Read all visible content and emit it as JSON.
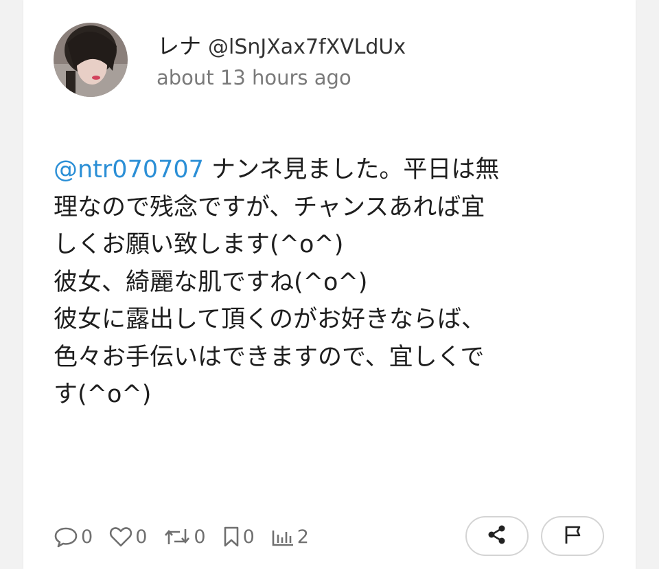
{
  "post": {
    "display_name": "レナ",
    "handle": "@lSnJXax7fXVLdUx",
    "timestamp": "about 13 hours ago",
    "mention": "@ntr070707",
    "lines": [
      " ナンネ見ました。平日は無",
      "理なので残念ですが、チャンスあれば宜",
      "しくお願い致します(^o^)",
      "彼女、綺麗な肌ですね(^o^)",
      "彼女に露出して頂くのがお好きならば、",
      "色々お手伝いはできますので、宜しくで",
      "す(^o^)"
    ]
  },
  "actions": {
    "replies": "0",
    "likes": "0",
    "reposts": "0",
    "bookmarks": "0",
    "views": "2"
  },
  "icons": {
    "reply": "comment-icon",
    "like": "heart-icon",
    "repost": "retweet-icon",
    "bookmark": "bookmark-icon",
    "views": "bar-chart-icon",
    "share": "share-icon",
    "report": "flag-icon"
  },
  "colors": {
    "mention": "#2b8fd6",
    "meta_text": "#7a7a7a",
    "action_text": "#6f6f6f"
  }
}
